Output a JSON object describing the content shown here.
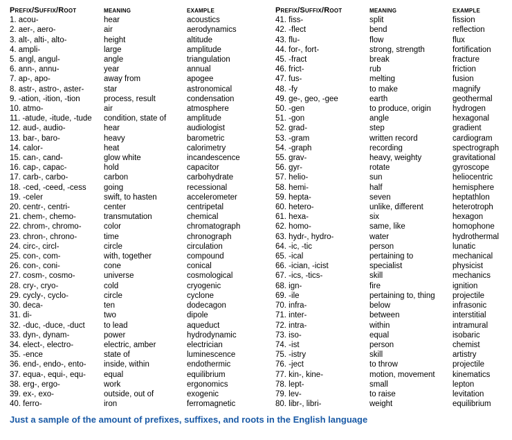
{
  "headers": {
    "col1": "Prefix/Suffix/Root",
    "col2": "meaning",
    "col3": "example"
  },
  "left": [
    {
      "n": "1.",
      "p": "acou-",
      "m": "hear",
      "e": "acoustics"
    },
    {
      "n": "2.",
      "p": "aer-, aero-",
      "m": "air",
      "e": "aerodynamics"
    },
    {
      "n": "3.",
      "p": "alt-, alti-, alto-",
      "m": "height",
      "e": "altitude"
    },
    {
      "n": "4.",
      "p": "ampli-",
      "m": "large",
      "e": "amplitude"
    },
    {
      "n": "5.",
      "p": "angl, angul-",
      "m": "angle",
      "e": "triangulation"
    },
    {
      "n": "6.",
      "p": "ann-, annu-",
      "m": "year",
      "e": "annual"
    },
    {
      "n": "7.",
      "p": "ap-, apo-",
      "m": "away from",
      "e": "apogee"
    },
    {
      "n": "8.",
      "p": "astr-, astro-, aster-",
      "m": "star",
      "e": "astronomical"
    },
    {
      "n": "9.",
      "p": "-ation, -ition, -tion",
      "m": "process, result",
      "e": "condensation"
    },
    {
      "n": "10.",
      "p": "atmo-",
      "m": "air",
      "e": "atmosphere"
    },
    {
      "n": "11.",
      "p": "-atude, -itude, -tude",
      "m": "condition, state of",
      "e": "amplitude"
    },
    {
      "n": "12.",
      "p": "aud-, audio-",
      "m": "hear",
      "e": "audiologist"
    },
    {
      "n": "13.",
      "p": "bar-, baro-",
      "m": "heavy",
      "e": "barometric"
    },
    {
      "n": "14.",
      "p": "calor-",
      "m": "heat",
      "e": "calorimetry"
    },
    {
      "n": "15.",
      "p": "can-, cand-",
      "m": "glow white",
      "e": "incandescence"
    },
    {
      "n": "16.",
      "p": "cap-, capac-",
      "m": "hold",
      "e": "capacitor"
    },
    {
      "n": "17.",
      "p": "carb-, carbo-",
      "m": "carbon",
      "e": "carbohydrate"
    },
    {
      "n": "18.",
      "p": "-ced, -ceed, -cess",
      "m": "going",
      "e": "recessional"
    },
    {
      "n": "19.",
      "p": "-celer",
      "m": "swift, to hasten",
      "e": "accelerometer"
    },
    {
      "n": "20.",
      "p": "centr-, centri-",
      "m": "center",
      "e": "centripetal"
    },
    {
      "n": "21.",
      "p": "chem-, chemo-",
      "m": "transmutation",
      "e": "chemical"
    },
    {
      "n": "22.",
      "p": "chrom-, chromo-",
      "m": "color",
      "e": "chromatograph"
    },
    {
      "n": "23.",
      "p": "chron-, chrono-",
      "m": "time",
      "e": "chronograph"
    },
    {
      "n": "24.",
      "p": "circ-, circl-",
      "m": "circle",
      "e": "circulation"
    },
    {
      "n": "25.",
      "p": "con-, com-",
      "m": "with, together",
      "e": "compound"
    },
    {
      "n": "26.",
      "p": "con-, coni-",
      "m": "cone",
      "e": "conical"
    },
    {
      "n": "27.",
      "p": "cosm-, cosmo-",
      "m": "universe",
      "e": "cosmological"
    },
    {
      "n": "28.",
      "p": "cry-, cryo-",
      "m": "cold",
      "e": "cryogenic"
    },
    {
      "n": "29.",
      "p": "cycly-, cyclo-",
      "m": "circle",
      "e": "cyclone"
    },
    {
      "n": "30.",
      "p": "deca-",
      "m": "ten",
      "e": "dodecagon"
    },
    {
      "n": "31.",
      "p": "di-",
      "m": "two",
      "e": "dipole"
    },
    {
      "n": "32.",
      "p": "-duc, -duce, -duct",
      "m": "to lead",
      "e": "aqueduct"
    },
    {
      "n": "33.",
      "p": "dyn-, dynam-",
      "m": "power",
      "e": "hydrodynamic"
    },
    {
      "n": "34.",
      "p": "elect-, electro-",
      "m": "electric, amber",
      "e": "electrician"
    },
    {
      "n": "35.",
      "p": "-ence",
      "m": "state of",
      "e": "luminescence"
    },
    {
      "n": "36.",
      "p": "end-, endo-, ento-",
      "m": "inside, within",
      "e": "endothermic"
    },
    {
      "n": "37.",
      "p": "equa-, equi-, equ-",
      "m": "equal",
      "e": "equilibrium"
    },
    {
      "n": "38.",
      "p": "erg-, ergo-",
      "m": "work",
      "e": "ergonomics"
    },
    {
      "n": "39.",
      "p": "ex-, exo-",
      "m": "outside, out of",
      "e": "exogenic"
    },
    {
      "n": "40.",
      "p": "ferro-",
      "m": "iron",
      "e": "ferromagnetic"
    }
  ],
  "right": [
    {
      "n": "41.",
      "p": "fiss-",
      "m": "split",
      "e": "fission"
    },
    {
      "n": "42.",
      "p": "-flect",
      "m": "bend",
      "e": "reflection"
    },
    {
      "n": "43.",
      "p": "flu-",
      "m": "flow",
      "e": "flux"
    },
    {
      "n": "44.",
      "p": "for-, fort-",
      "m": "strong, strength",
      "e": "fortification"
    },
    {
      "n": "45.",
      "p": "-fract",
      "m": "break",
      "e": "fracture"
    },
    {
      "n": "46.",
      "p": "frict-",
      "m": "rub",
      "e": "friction"
    },
    {
      "n": "47.",
      "p": "fus-",
      "m": "melting",
      "e": "fusion"
    },
    {
      "n": "48.",
      "p": "-fy",
      "m": "to make",
      "e": "magnify"
    },
    {
      "n": "49.",
      "p": "ge-, geo, -gee",
      "m": "earth",
      "e": "geothermal"
    },
    {
      "n": "50.",
      "p": "-gen",
      "m": "to produce, origin",
      "e": "hydrogen"
    },
    {
      "n": "51.",
      "p": "-gon",
      "m": "angle",
      "e": "hexagonal"
    },
    {
      "n": "52.",
      "p": "grad-",
      "m": "step",
      "e": "gradient"
    },
    {
      "n": "53.",
      "p": "-gram",
      "m": "written record",
      "e": "cardiogram"
    },
    {
      "n": "54.",
      "p": "-graph",
      "m": "recording",
      "e": "spectrograph"
    },
    {
      "n": "55.",
      "p": "grav-",
      "m": "heavy, weighty",
      "e": "gravitational"
    },
    {
      "n": "56.",
      "p": "gyr-",
      "m": "rotate",
      "e": "gyroscope"
    },
    {
      "n": "57.",
      "p": "helio-",
      "m": "sun",
      "e": "heliocentric"
    },
    {
      "n": "58.",
      "p": "hemi-",
      "m": "half",
      "e": "hemisphere"
    },
    {
      "n": "59.",
      "p": "hepta-",
      "m": "seven",
      "e": "heptathlon"
    },
    {
      "n": "60.",
      "p": "hetero-",
      "m": "unlike, different",
      "e": "heterotroph"
    },
    {
      "n": "61.",
      "p": "hexa-",
      "m": "six",
      "e": "hexagon"
    },
    {
      "n": "62.",
      "p": "homo-",
      "m": "same, like",
      "e": "homophone"
    },
    {
      "n": "63.",
      "p": "hydr-, hydro-",
      "m": "water",
      "e": "hydrothermal"
    },
    {
      "n": "64.",
      "p": "-ic, -tic",
      "m": "person",
      "e": "lunatic"
    },
    {
      "n": "65.",
      "p": "-ical",
      "m": "pertaining to",
      "e": "mechanical"
    },
    {
      "n": "66.",
      "p": "-ician, -icist",
      "m": "specialist",
      "e": "physicist"
    },
    {
      "n": "67.",
      "p": "-ics, -tics-",
      "m": "skill",
      "e": "mechanics"
    },
    {
      "n": "68.",
      "p": "ign-",
      "m": "fire",
      "e": "ignition"
    },
    {
      "n": "69.",
      "p": "-ile",
      "m": "pertaining to, thing",
      "e": "projectile"
    },
    {
      "n": "70.",
      "p": "infra-",
      "m": "below",
      "e": "infrasonic"
    },
    {
      "n": "71.",
      "p": "inter-",
      "m": "between",
      "e": "interstitial"
    },
    {
      "n": "72.",
      "p": "intra-",
      "m": "within",
      "e": "intramural"
    },
    {
      "n": "73.",
      "p": "iso-",
      "m": "equal",
      "e": "isobaric"
    },
    {
      "n": "74.",
      "p": "-ist",
      "m": "person",
      "e": "chemist"
    },
    {
      "n": "75.",
      "p": "-istry",
      "m": "skill",
      "e": "artistry"
    },
    {
      "n": "76.",
      "p": "-ject",
      "m": "to throw",
      "e": "projectile"
    },
    {
      "n": "77.",
      "p": "kin-, kine-",
      "m": "motion, movement",
      "e": "kinematics"
    },
    {
      "n": "78.",
      "p": "lept-",
      "m": "small",
      "e": "lepton"
    },
    {
      "n": "79.",
      "p": "lev-",
      "m": "to raise",
      "e": "levitation"
    },
    {
      "n": "80.",
      "p": "libr-, libri-",
      "m": "weight",
      "e": "equilibrium"
    }
  ],
  "caption": "Just a sample of the amount of prefixes, suffixes, and roots in the English language"
}
